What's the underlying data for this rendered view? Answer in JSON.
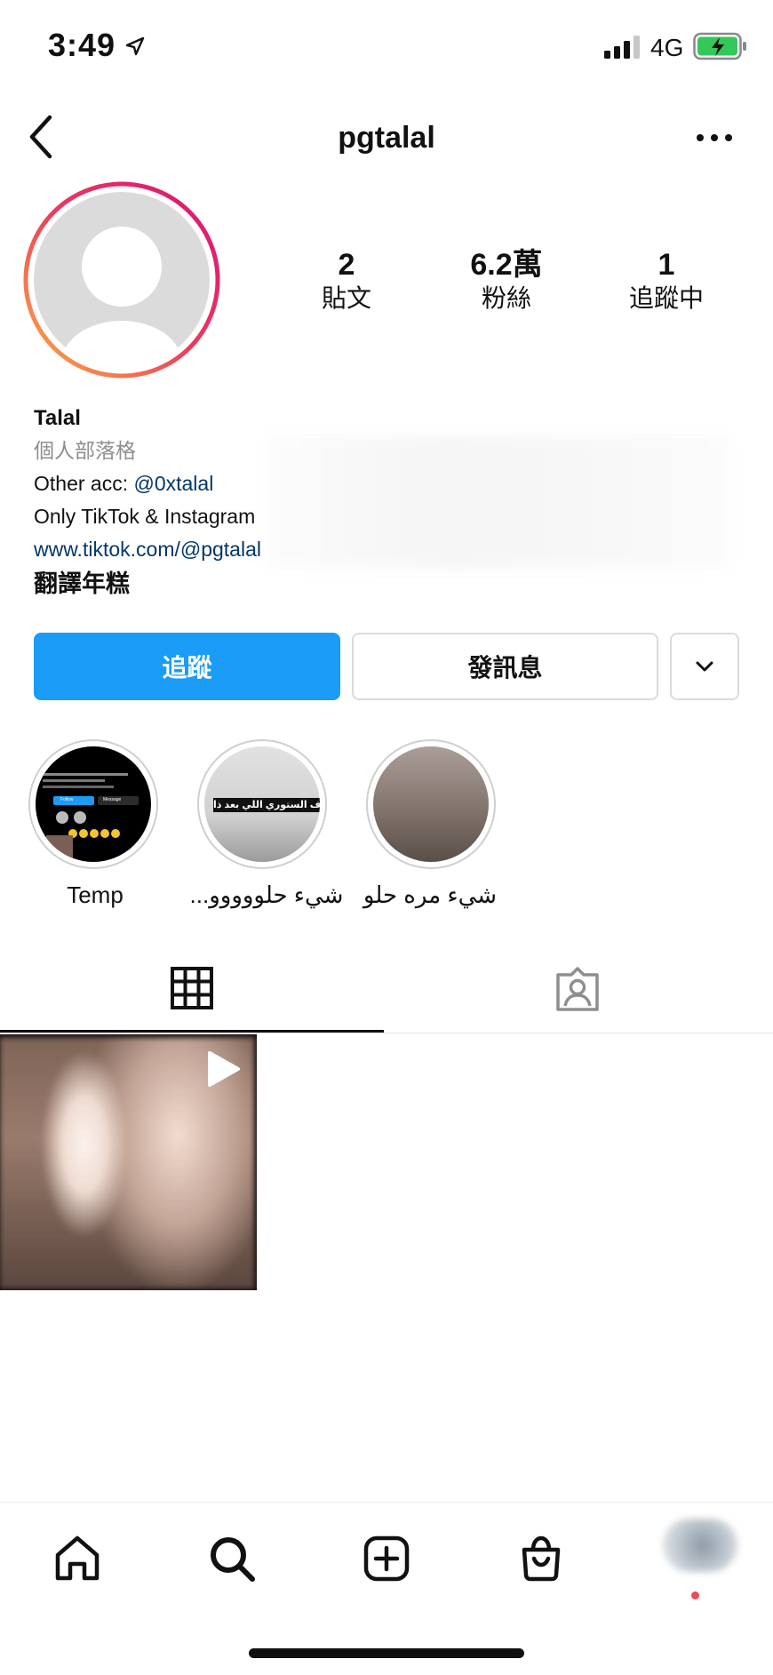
{
  "status_bar": {
    "time": "3:49",
    "network": "4G"
  },
  "header": {
    "username": "pgtalal"
  },
  "stats": [
    {
      "value": "2",
      "label": "貼文"
    },
    {
      "value": "6.2萬",
      "label": "粉絲"
    },
    {
      "value": "1",
      "label": "追蹤中"
    }
  ],
  "bio": {
    "name": "Talal",
    "category": "個人部落格",
    "other_prefix": "Other acc: ",
    "other_mention": "@0xtalal",
    "line3": "Only TikTok & Instagram",
    "website": "www.tiktok.com/@pgtalal",
    "translate": "翻譯年糕"
  },
  "actions": {
    "follow": "追蹤",
    "message": "發訊息"
  },
  "highlights": [
    {
      "label": "Temp",
      "buttons": {
        "follow": "Follow",
        "message": "Message"
      }
    },
    {
      "label": "...شيء حلووووو",
      "overlay_text": "وف الستوري اللي بعد ذا"
    },
    {
      "label": "شيء مره حلو"
    }
  ],
  "tabs": [
    "posts-grid",
    "tagged"
  ],
  "colors": {
    "accent": "#1a9cf7",
    "link": "#00376b",
    "notification_dot": "#ed4956"
  }
}
